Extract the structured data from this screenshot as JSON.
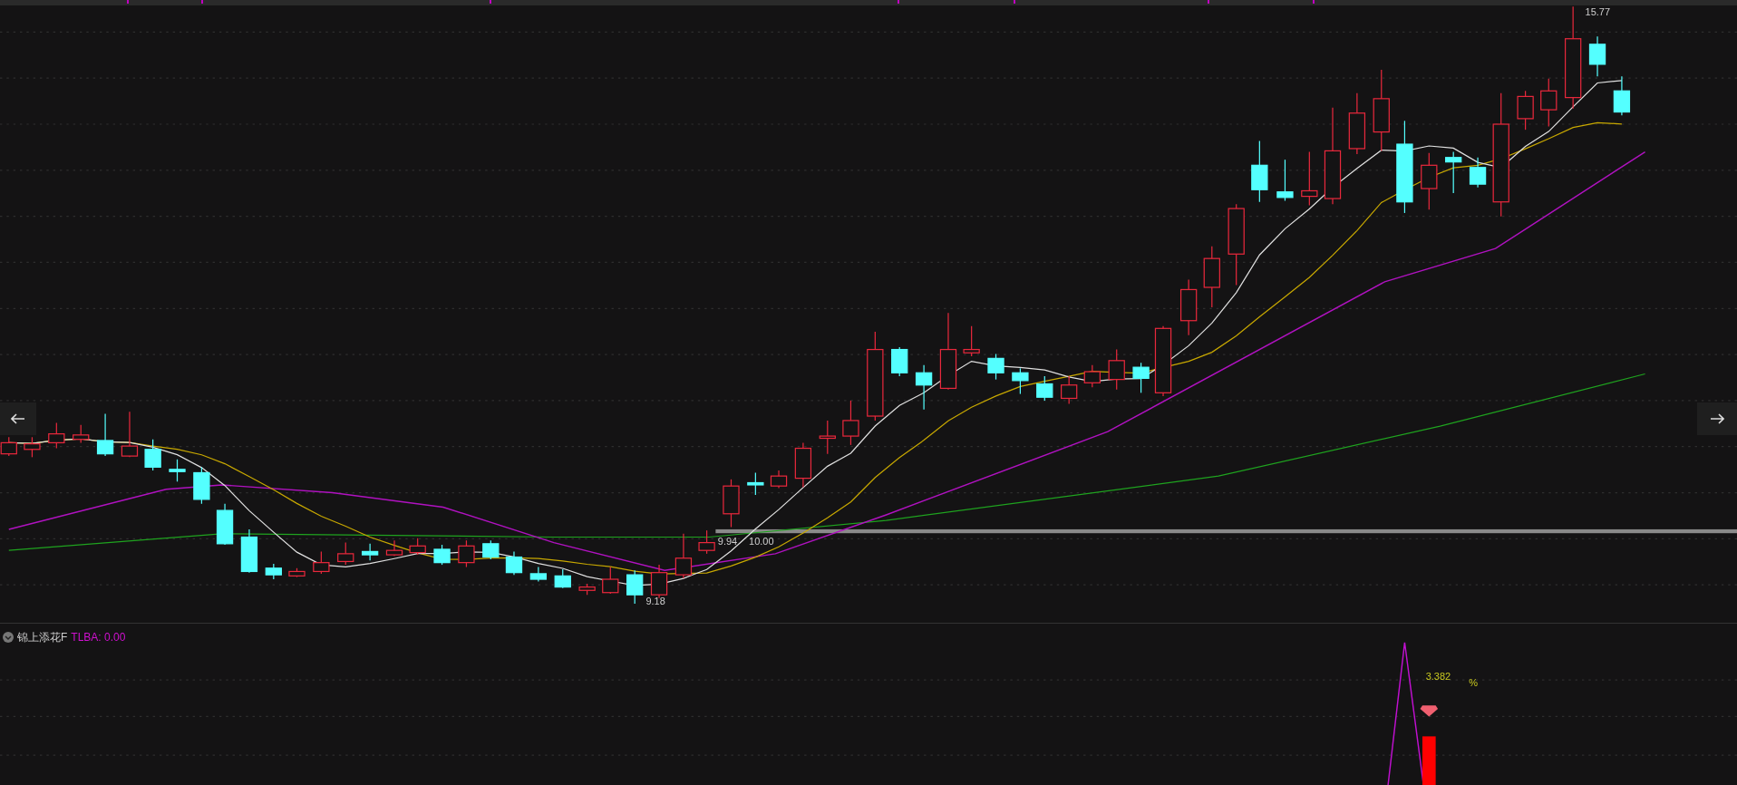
{
  "chart": {
    "high_label": "15.77",
    "low_label": "9.18",
    "price_labels": [
      "9.94",
      "10.00"
    ]
  },
  "indicator": {
    "name": "锦上添花F",
    "reading": "TLBA: 0.00",
    "value": "3.382",
    "unit": "%"
  }
}
